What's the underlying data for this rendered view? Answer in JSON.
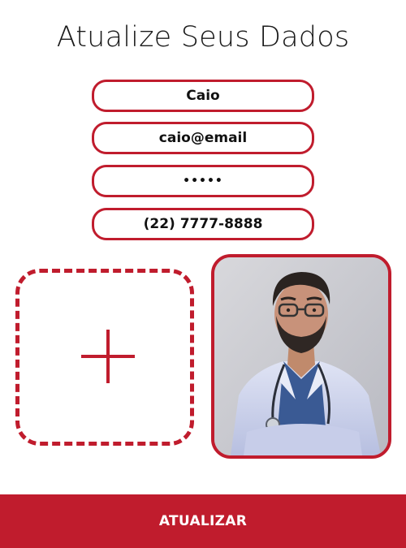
{
  "page": {
    "title": "Atualize Seus Dados"
  },
  "form": {
    "name_value": "Caio",
    "email_value": "caio@email",
    "password_value": "•••••",
    "phone_value": "(22) 7777-8888"
  },
  "photo": {
    "add_icon": "plus-icon",
    "profile_description_icon": "doctor-avatar-photo"
  },
  "actions": {
    "submit_label": "ATUALIZAR"
  },
  "colors": {
    "accent": "#c01c2d",
    "background": "#ffffff"
  }
}
